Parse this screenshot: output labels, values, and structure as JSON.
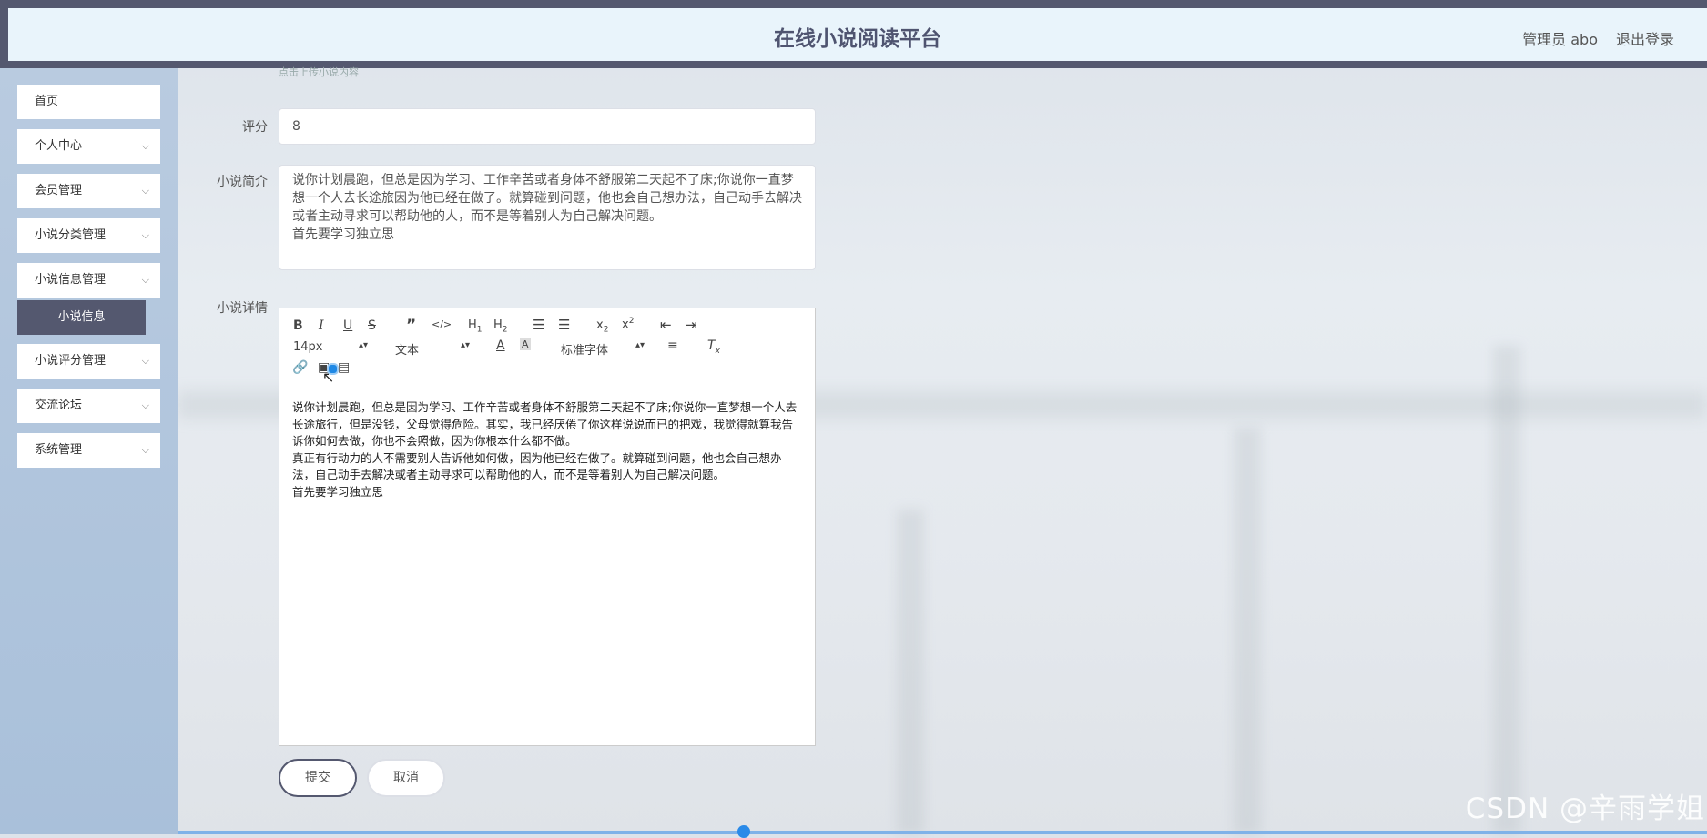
{
  "header": {
    "title": "在线小说阅读平台",
    "admin": "管理员 abo",
    "logout": "退出登录"
  },
  "sidebar": {
    "items": [
      {
        "label": "首页",
        "has_chevron": false
      },
      {
        "label": "个人中心",
        "has_chevron": true
      },
      {
        "label": "会员管理",
        "has_chevron": true
      },
      {
        "label": "小说分类管理",
        "has_chevron": true
      },
      {
        "label": "小说信息管理",
        "has_chevron": true
      },
      {
        "label": "小说评分管理",
        "has_chevron": true
      },
      {
        "label": "交流论坛",
        "has_chevron": true
      },
      {
        "label": "系统管理",
        "has_chevron": true
      }
    ],
    "active_subitem": "小说信息"
  },
  "form": {
    "upload_hint": "点击上传小说内容",
    "score_label": "评分",
    "score_value": "8",
    "intro_label": "小说简介",
    "intro_value": "说你计划晨跑，但总是因为学习、工作辛苦或者身体不舒服第二天起不了床;你说你一直梦想一个人去长途旅因为他已经在做了。就算碰到问题，他也会自己想办法，自己动手去解决或者主动寻求可以帮助他的人，而不是等着别人为自己解决问题。\n首先要学习独立思",
    "details_label": "小说详情",
    "editor": {
      "font_size": "14px",
      "text_type": "文本",
      "font_family": "标准字体",
      "content": "说你计划晨跑，但总是因为学习、工作辛苦或者身体不舒服第二天起不了床;你说你一直梦想一个人去长途旅行，但是没钱，父母觉得危险。其实，我已经厌倦了你这样说说而已的把戏，我觉得就算我告诉你如何去做，你也不会照做，因为你根本什么都不做。\n真正有行动力的人不需要别人告诉他如何做，因为他已经在做了。就算碰到问题，他也会自己想办法，自己动手去解决或者主动寻求可以帮助他的人，而不是等着别人为自己解决问题。\n首先要学习独立思"
    },
    "submit": "提交",
    "cancel": "取消"
  },
  "watermark": "CSDN @辛雨学姐",
  "colors": {
    "accent": "#54586f",
    "header_bg": "#e9f4fb",
    "sidebar_bg": "#b1c6dd"
  }
}
